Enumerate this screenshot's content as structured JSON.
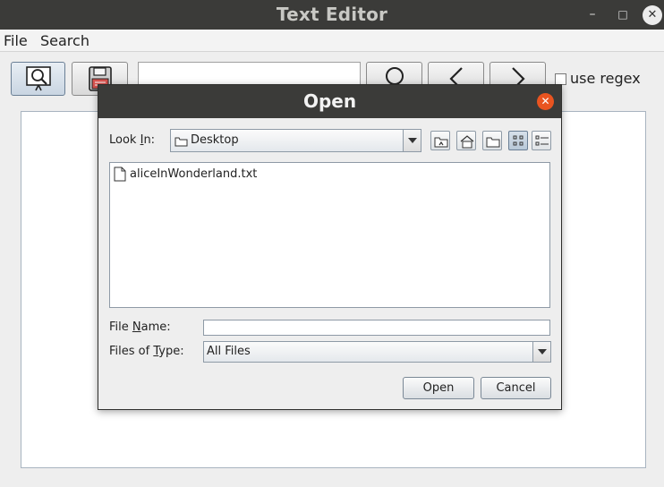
{
  "window": {
    "title": "Text Editor"
  },
  "menubar": {
    "file": "File",
    "search": "Search"
  },
  "toolbar": {
    "search_value": "",
    "use_regex_label": "use regex",
    "use_regex_checked": false
  },
  "dialog": {
    "title": "Open",
    "look_in_pre": "Look ",
    "look_in_key": "I",
    "look_in_post": "n:",
    "look_in_value": "Desktop",
    "files": [
      {
        "name": "aliceInWonderland.txt"
      }
    ],
    "file_name_pre": "File ",
    "file_name_key": "N",
    "file_name_post": "ame:",
    "file_name_value": "",
    "files_of_type_pre": "Files of ",
    "files_of_type_key": "T",
    "files_of_type_post": "ype:",
    "files_of_type_value": "All Files",
    "open_button": "Open",
    "cancel_button": "Cancel",
    "view_mode": "list"
  },
  "colors": {
    "titlebar": "#3b3b39",
    "close_accent": "#e95420",
    "selected_button": "#c9d5e2"
  }
}
